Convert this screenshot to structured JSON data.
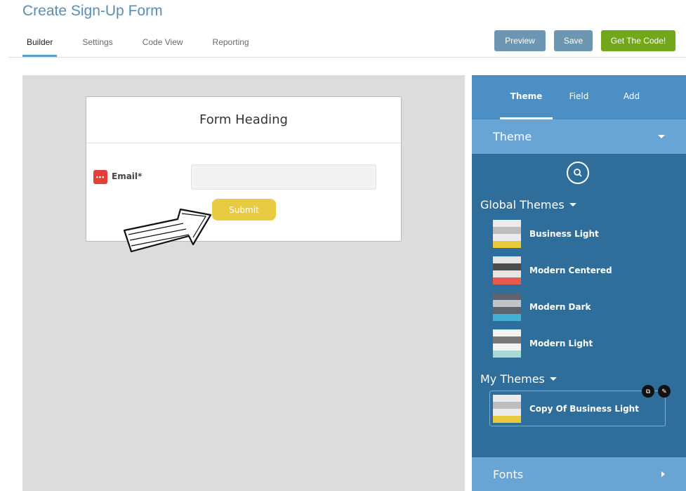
{
  "header": {
    "title": "Create Sign-Up Form",
    "tabs": [
      {
        "label": "Builder",
        "active": true
      },
      {
        "label": "Settings",
        "active": false
      },
      {
        "label": "Code View",
        "active": false
      },
      {
        "label": "Reporting",
        "active": false
      }
    ],
    "buttons": {
      "preview": "Preview",
      "save": "Save",
      "get_code": "Get The Code!"
    }
  },
  "form": {
    "heading": "Form Heading",
    "email_label": "Email*",
    "email_icon": "email-dots-icon",
    "submit_label": "Submit"
  },
  "panel": {
    "tabs": [
      {
        "label": "Theme",
        "active": true
      },
      {
        "label": "Field",
        "active": false
      },
      {
        "label": "Add",
        "active": false
      }
    ],
    "theme_section": "Theme",
    "global_heading": "Global Themes",
    "global_themes": [
      {
        "name": "Business Light",
        "colors": [
          "#ebebeb",
          "#bdbdbd",
          "#ebebeb",
          "#e8c93c"
        ]
      },
      {
        "name": "Modern Centered",
        "colors": [
          "#e5e5e5",
          "#4b4b4b",
          "#e5e5e5",
          "#e75b4d"
        ]
      },
      {
        "name": "Modern Dark",
        "colors": [
          "#5d6470",
          "#c0c3c8",
          "#5d6470",
          "#43b0d5"
        ]
      },
      {
        "name": "Modern Light",
        "colors": [
          "#f2f2f2",
          "#777777",
          "#f2f2f2",
          "#a7d9d6"
        ]
      }
    ],
    "my_heading": "My Themes",
    "my_themes": [
      {
        "name": "Copy Of Business Light",
        "colors": [
          "#ebebeb",
          "#bdbdbd",
          "#ebebeb",
          "#e8c93c"
        ]
      }
    ],
    "fonts_section": "Fonts"
  },
  "colors": {
    "accent_blue": "#5b8db3",
    "panel_dark": "#2f6d9a",
    "panel_mid": "#68a4d4",
    "get_code_green": "#72a61b",
    "submit_yellow": "#e8cb41"
  }
}
